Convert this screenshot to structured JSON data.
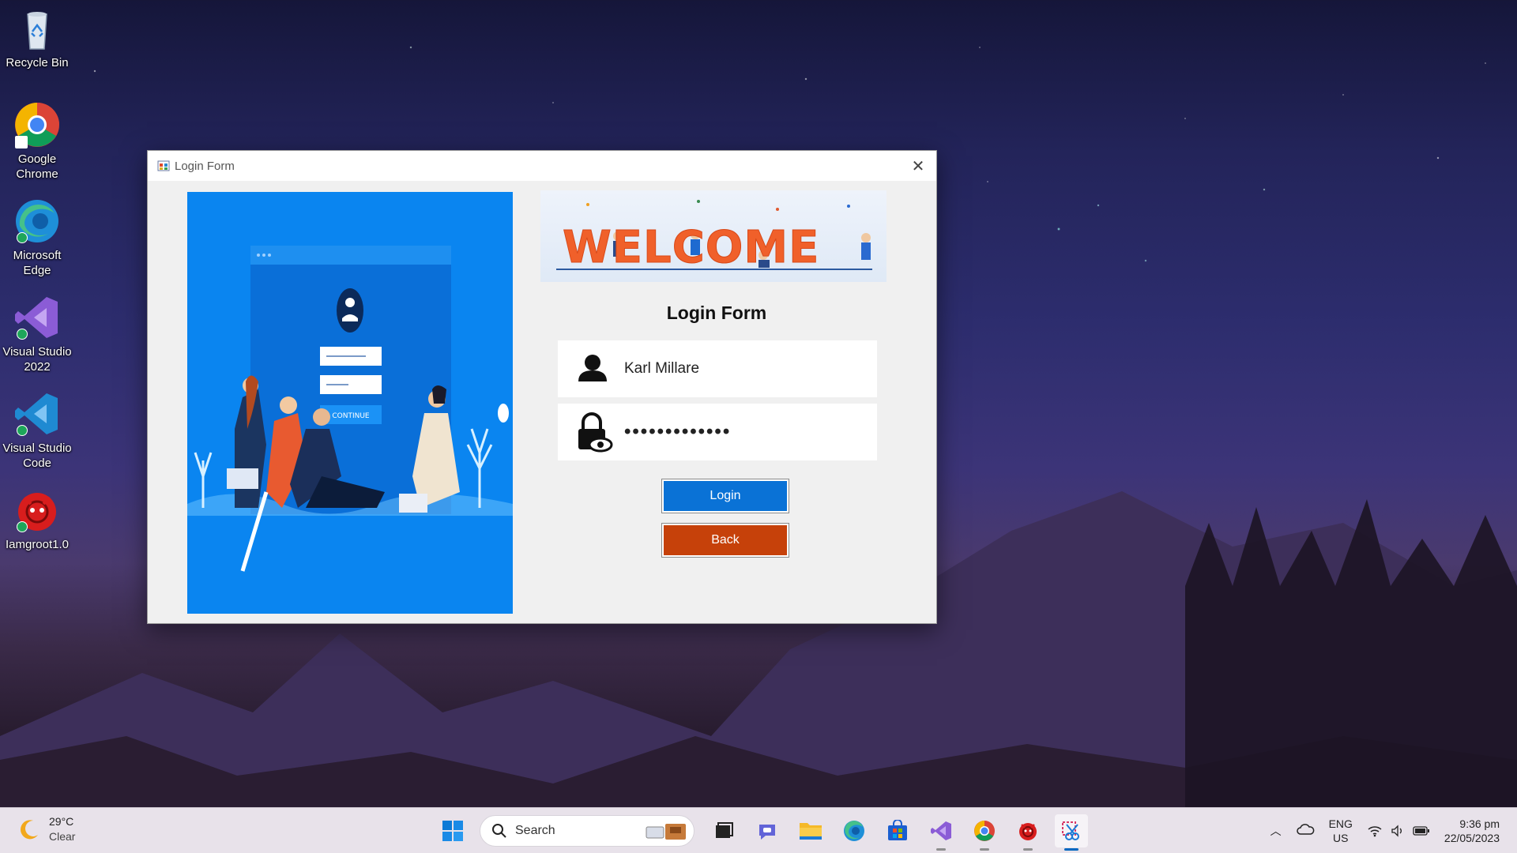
{
  "desktop": {
    "icons": [
      {
        "label": "Recycle Bin",
        "icon": "recycle-bin-icon"
      },
      {
        "label": "Google Chrome",
        "icon": "chrome-icon"
      },
      {
        "label": "Microsoft Edge",
        "icon": "edge-icon"
      },
      {
        "label": "Visual Studio 2022",
        "icon": "visual-studio-icon"
      },
      {
        "label": "Visual Studio Code",
        "icon": "vscode-icon"
      },
      {
        "label": "Iamgroot1.0",
        "icon": "iamgroot-app-icon"
      }
    ]
  },
  "window": {
    "title": "Login Form",
    "banner_text": "WELCOME",
    "form_title": "Login Form",
    "username_value": "Karl Millare",
    "password_value": "●●●●●●●●●●●●●",
    "login_label": "Login",
    "back_label": "Back",
    "colors": {
      "login": "#0a72d6",
      "back": "#c6410a",
      "illustration_bg": "#0a85f0",
      "welcome": "#f0602a"
    },
    "illustration": {
      "continue_label": "CONTINUE"
    }
  },
  "taskbar": {
    "weather_temp": "29°C",
    "weather_desc": "Clear",
    "search_label": "Search",
    "apps": [
      "windows-start-icon",
      "task-view-icon",
      "teams-chat-icon",
      "file-explorer-icon",
      "edge-icon",
      "ms-store-icon",
      "visual-studio-icon",
      "chrome-icon",
      "iamgroot-app-icon",
      "snipping-tool-icon"
    ],
    "lang_top": "ENG",
    "lang_bottom": "US",
    "time": "9:36 pm",
    "date": "22/05/2023"
  }
}
